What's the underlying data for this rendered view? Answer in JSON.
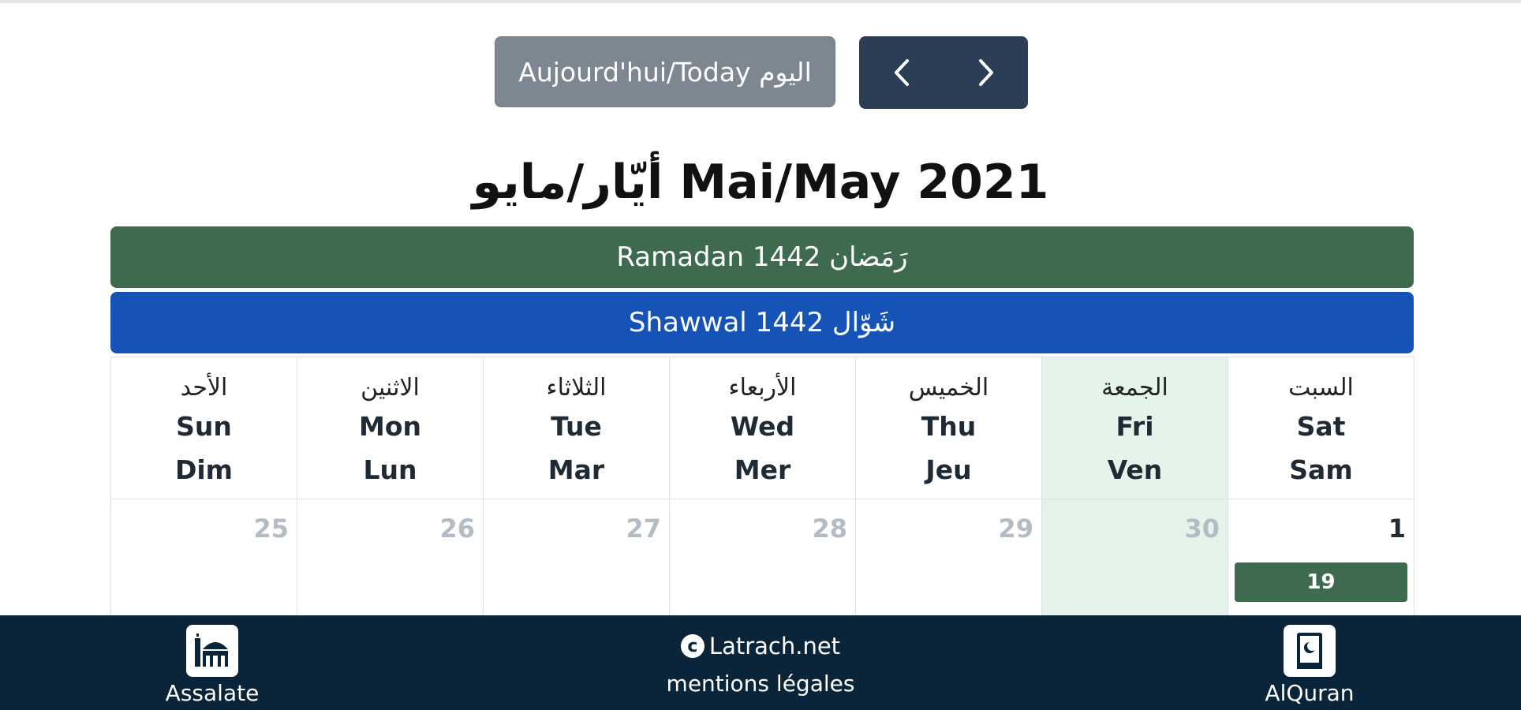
{
  "toolbar": {
    "today_label": "Aujourd'hui/Today اليوم",
    "prev_icon": "chevron-left-icon",
    "next_icon": "chevron-right-icon"
  },
  "month_title": "أيّار/مايو Mai/May 2021",
  "hijri_months": [
    {
      "label": "Ramadan 1442 رَمَضان",
      "color": "#3e6a4d"
    },
    {
      "label": "Shawwal 1442 شَوّال",
      "color": "#1553b6"
    }
  ],
  "weekdays": [
    {
      "ar": "الأحد",
      "en": "Sun",
      "fr": "Dim"
    },
    {
      "ar": "الاثنين",
      "en": "Mon",
      "fr": "Lun"
    },
    {
      "ar": "الثلاثاء",
      "en": "Tue",
      "fr": "Mar"
    },
    {
      "ar": "الأربعاء",
      "en": "Wed",
      "fr": "Mer"
    },
    {
      "ar": "الخميس",
      "en": "Thu",
      "fr": "Jeu"
    },
    {
      "ar": "الجمعة",
      "en": "Fri",
      "fr": "Ven"
    },
    {
      "ar": "السبت",
      "en": "Sat",
      "fr": "Sam"
    }
  ],
  "week1": [
    {
      "day": "25"
    },
    {
      "day": "26"
    },
    {
      "day": "27"
    },
    {
      "day": "28"
    },
    {
      "day": "29"
    },
    {
      "day": "30"
    },
    {
      "day": "1",
      "hijri_day": "19"
    }
  ],
  "footer": {
    "left_label": "Assalate",
    "left_icon": "mosque-icon",
    "center_copyright": "Latrach.net",
    "center_legal": "mentions légales",
    "right_label": "AlQuran",
    "right_icon": "quran-book-icon"
  },
  "colors": {
    "friday_highlight": "#e5f4ea",
    "footer_bg": "#0a2539",
    "nav_button_bg": "#2c3e55",
    "today_button_bg": "#7d8791"
  }
}
